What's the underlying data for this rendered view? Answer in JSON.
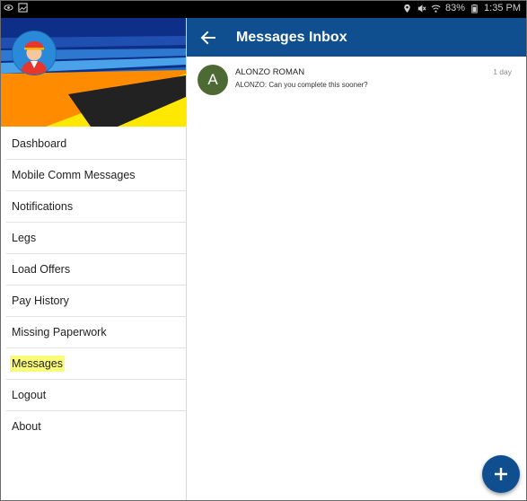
{
  "status_bar": {
    "left_icons": [
      "eye-icon",
      "image-icon"
    ],
    "battery": "83%",
    "time": "1:35 PM",
    "right_icons": [
      "location-icon",
      "mute-icon",
      "wifi-icon",
      "battery-icon"
    ]
  },
  "drawer": {
    "banner_colors": [
      "#0d2f88",
      "#ff8c00",
      "#ffe800",
      "#222222"
    ],
    "menu": [
      {
        "label": "Dashboard"
      },
      {
        "label": "Mobile Comm Messages"
      },
      {
        "label": "Notifications"
      },
      {
        "label": "Legs"
      },
      {
        "label": "Load Offers"
      },
      {
        "label": "Pay History"
      },
      {
        "label": "Missing Paperwork"
      },
      {
        "label": "Messages",
        "highlighted": true
      },
      {
        "label": "Logout"
      },
      {
        "label": "About"
      }
    ]
  },
  "appbar": {
    "title": "Messages Inbox",
    "color": "#0f4f8f"
  },
  "messages": [
    {
      "initial": "A",
      "from": "ALONZO ROMAN",
      "time": "1 day",
      "preview": "ALONZO: Can you complete this sooner?"
    }
  ],
  "fab": {
    "icon": "plus-icon"
  }
}
